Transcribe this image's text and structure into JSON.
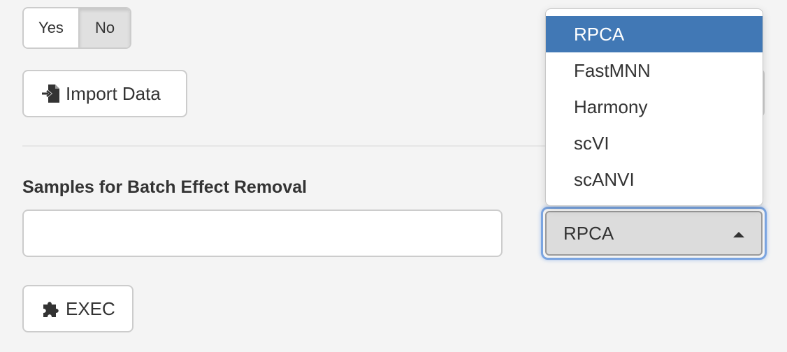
{
  "toggle": {
    "options": [
      {
        "label": "Yes",
        "selected": false
      },
      {
        "label": "No",
        "selected": true
      }
    ]
  },
  "import_button": {
    "label": "Import Data",
    "icon": "file-import-icon"
  },
  "batch_section": {
    "label": "Samples for Batch Effect Removal"
  },
  "samples_input": {
    "value": "",
    "placeholder": ""
  },
  "method_select": {
    "selected": "RPCA",
    "options": [
      "RPCA",
      "FastMNN",
      "Harmony",
      "scVI",
      "scANVI"
    ],
    "highlighted_index": 0
  },
  "exec_button": {
    "label": "EXEC",
    "icon": "puzzle-piece-icon"
  },
  "colors": {
    "highlight": "#4178b5",
    "focus_ring": "#7aa4e0",
    "background": "#f4f4f4"
  }
}
